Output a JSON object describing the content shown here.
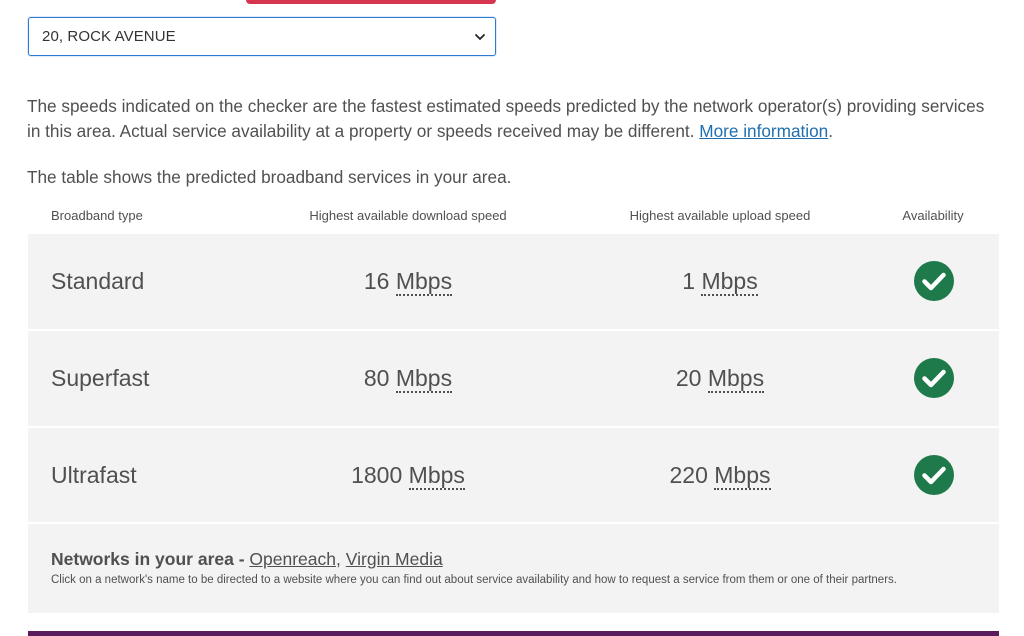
{
  "address_select": {
    "selected": "20, ROCK AVENUE"
  },
  "intro": {
    "text": "The speeds indicated on the checker are the fastest estimated speeds predicted by the network operator(s) providing services in this area. Actual service availability at a property or speeds received may be different. ",
    "link": "More information",
    "after_link": "."
  },
  "table_intro": "The table shows the predicted broadband services in your area.",
  "table": {
    "headers": {
      "type": "Broadband type",
      "download": "Highest available download speed",
      "upload": "Highest available upload speed",
      "availability": "Availability"
    },
    "rows": [
      {
        "type": "Standard",
        "download": "16",
        "upload": "1",
        "unit": "Mbps",
        "available": true
      },
      {
        "type": "Superfast",
        "download": "80",
        "upload": "20",
        "unit": "Mbps",
        "available": true
      },
      {
        "type": "Ultrafast",
        "download": "1800",
        "upload": "220",
        "unit": "Mbps",
        "available": true
      }
    ]
  },
  "networks": {
    "label": "Networks in your area -",
    "items": [
      "Openreach",
      "Virgin Media"
    ],
    "separator": ",",
    "note": "Click on a network's name to be directed to a website where you can find out about service availability and how to request a service from them or one of their partners."
  },
  "colors": {
    "accent_top": "#d6354f",
    "check_green": "#1e7a4a",
    "link_blue": "#1f6fb0",
    "footer_purple": "#5a1c5c"
  },
  "icons": {
    "select_arrow": "chevron-down-icon",
    "availability": "check-circle-icon"
  }
}
